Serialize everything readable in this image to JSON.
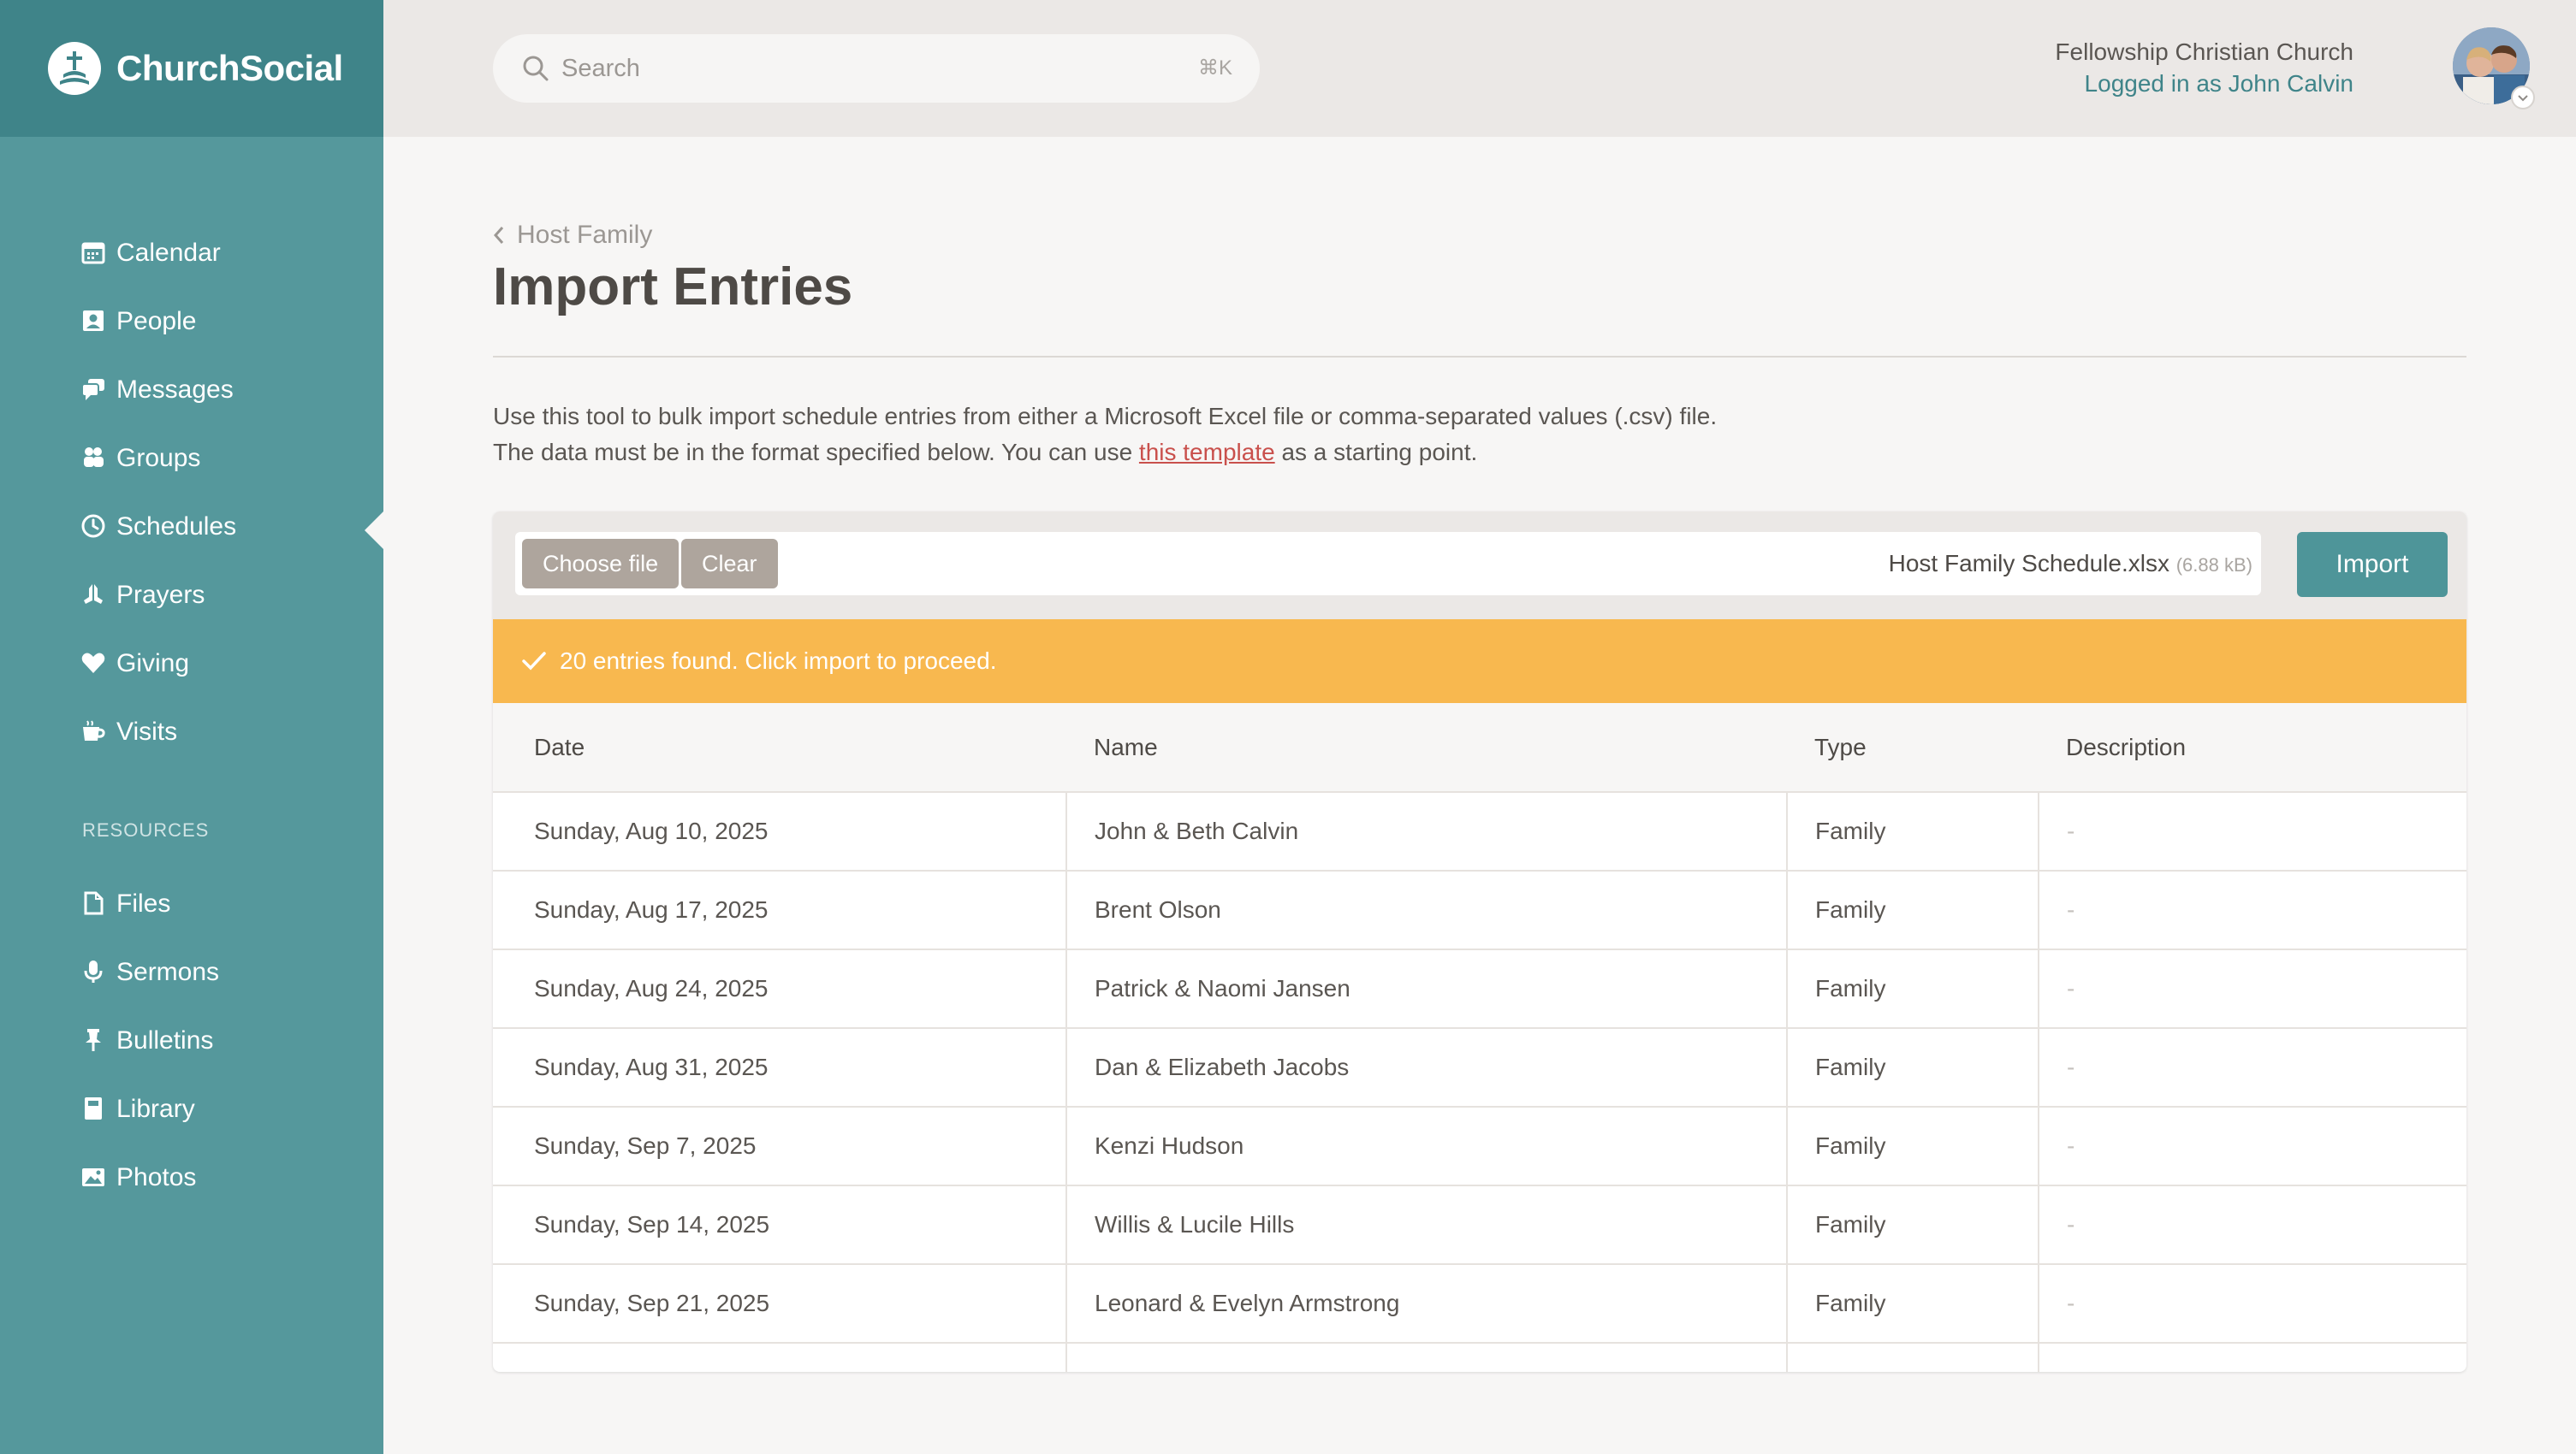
{
  "app": {
    "name": "ChurchSocial"
  },
  "sidebar": {
    "items": [
      {
        "label": "Calendar",
        "icon": "calendar-icon"
      },
      {
        "label": "People",
        "icon": "people-icon"
      },
      {
        "label": "Messages",
        "icon": "messages-icon"
      },
      {
        "label": "Groups",
        "icon": "groups-icon"
      },
      {
        "label": "Schedules",
        "icon": "clock-icon",
        "active": true
      },
      {
        "label": "Prayers",
        "icon": "praying-hands-icon"
      },
      {
        "label": "Giving",
        "icon": "heart-icon"
      },
      {
        "label": "Visits",
        "icon": "coffee-cup-icon"
      }
    ],
    "resources_heading": "RESOURCES",
    "resources": [
      {
        "label": "Files",
        "icon": "file-icon"
      },
      {
        "label": "Sermons",
        "icon": "microphone-icon"
      },
      {
        "label": "Bulletins",
        "icon": "pin-icon"
      },
      {
        "label": "Library",
        "icon": "book-icon"
      },
      {
        "label": "Photos",
        "icon": "photo-icon"
      }
    ]
  },
  "header": {
    "search_placeholder": "Search",
    "search_shortcut": "⌘K",
    "org_name": "Fellowship Christian Church",
    "logged_in": "Logged in as John Calvin"
  },
  "page": {
    "breadcrumb": "Host Family",
    "title": "Import Entries",
    "intro_line1": "Use this tool to bulk import schedule entries from either a Microsoft Excel file or comma-separated values (.csv) file.",
    "intro_line2_before": "The data must be in the format specified below. You can use ",
    "intro_link": "this template",
    "intro_line2_after": " as a starting point."
  },
  "upload": {
    "choose_label": "Choose file",
    "clear_label": "Clear",
    "file_name": "Host Family Schedule.xlsx",
    "file_size": "(6.88 kB)",
    "import_label": "Import"
  },
  "alert": {
    "message": "20 entries found. Click import to proceed."
  },
  "table": {
    "columns": [
      "Date",
      "Name",
      "Type",
      "Description"
    ],
    "rows": [
      [
        "Sunday, Aug 10, 2025",
        "John & Beth Calvin",
        "Family",
        "-"
      ],
      [
        "Sunday, Aug 17, 2025",
        "Brent Olson",
        "Family",
        "-"
      ],
      [
        "Sunday, Aug 24, 2025",
        "Patrick & Naomi Jansen",
        "Family",
        "-"
      ],
      [
        "Sunday, Aug 31, 2025",
        "Dan & Elizabeth Jacobs",
        "Family",
        "-"
      ],
      [
        "Sunday, Sep 7, 2025",
        "Kenzi Hudson",
        "Family",
        "-"
      ],
      [
        "Sunday, Sep 14, 2025",
        "Willis & Lucile Hills",
        "Family",
        "-"
      ],
      [
        "Sunday, Sep 21, 2025",
        "Leonard & Evelyn Armstrong",
        "Family",
        "-"
      ]
    ]
  },
  "colors": {
    "sidebar": "#55989c",
    "brand_bar": "#3f8489",
    "accent": "#4e9599",
    "alert": "#f8b84f",
    "link": "#c9504c"
  }
}
